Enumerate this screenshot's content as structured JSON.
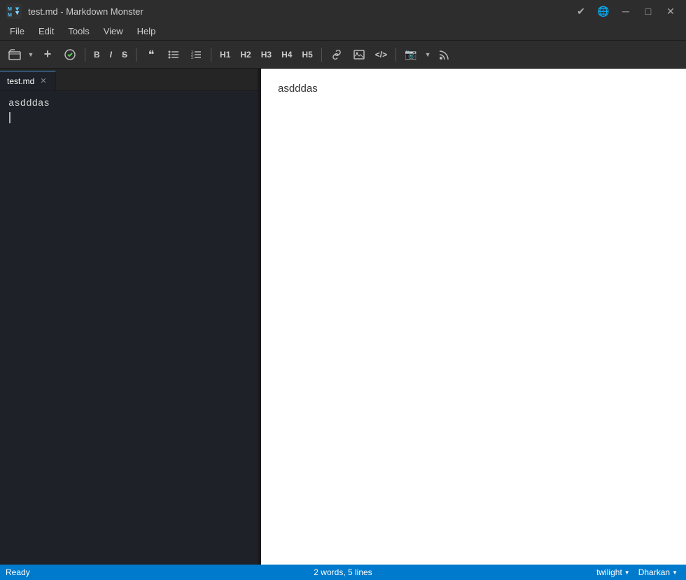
{
  "titleBar": {
    "filename": "test.md",
    "appName": "Markdown Monster",
    "checkIcon": "✔",
    "globeIcon": "🌐",
    "minimizeIcon": "─",
    "maximizeIcon": "□",
    "closeIcon": "✕"
  },
  "menuBar": {
    "items": [
      "File",
      "Edit",
      "Tools",
      "View",
      "Help"
    ]
  },
  "toolbar": {
    "newDropdownIcon": "📄",
    "newIcon": "+",
    "saveIcon": "💾",
    "boldLabel": "B",
    "italicLabel": "I",
    "strikeLabel": "S",
    "quoteIcon": "❝",
    "listIcon": "≡",
    "orderedListIcon": "≣",
    "h1Label": "H1",
    "h2Label": "H2",
    "h3Label": "H3",
    "h4Label": "H4",
    "h5Label": "H5",
    "linkIcon": "🔗",
    "imageIcon": "🖼",
    "codeIcon": "</>",
    "cameraIcon": "📷",
    "rssIcon": "📡"
  },
  "tabs": [
    {
      "label": "test.md",
      "active": true
    }
  ],
  "editor": {
    "content": "asdddas",
    "cursorLine": 2
  },
  "preview": {
    "content": "asdddas"
  },
  "statusBar": {
    "readyText": "Ready",
    "wordCount": "2 words, 5 lines",
    "theme": "twilight",
    "font": "Dharkan",
    "dropdownArrow": "▼"
  }
}
